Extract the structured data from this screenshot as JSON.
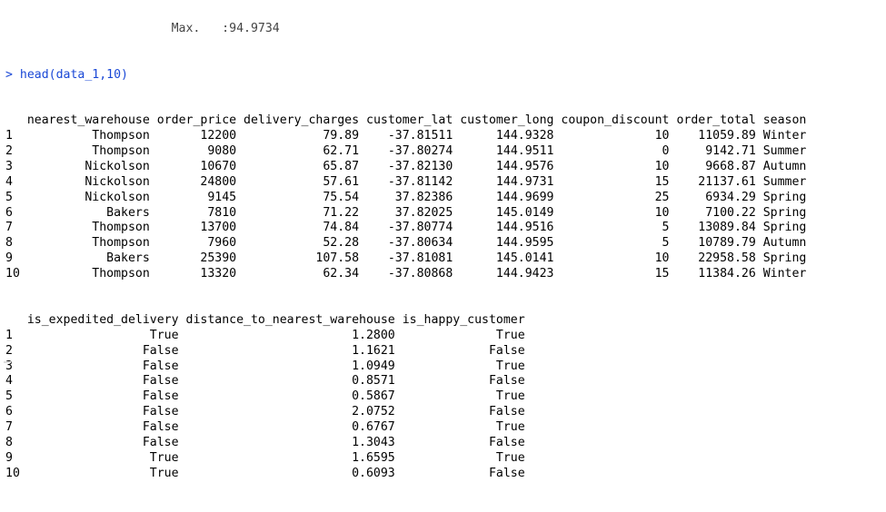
{
  "console": {
    "cut_line": "                       Max.   :94.9734",
    "prompt_symbol": ">",
    "command": "head(data_1,10)",
    "table1": {
      "headers": [
        "nearest_warehouse",
        "order_price",
        "delivery_charges",
        "customer_lat",
        "customer_long",
        "coupon_discount",
        "order_total",
        "season"
      ],
      "rows": [
        [
          "1",
          "Thompson",
          "12200",
          "79.89",
          "-37.81511",
          "144.9328",
          "10",
          "11059.89",
          "Winter"
        ],
        [
          "2",
          "Thompson",
          "9080",
          "62.71",
          "-37.80274",
          "144.9511",
          "0",
          "9142.71",
          "Summer"
        ],
        [
          "3",
          "Nickolson",
          "10670",
          "65.87",
          "-37.82130",
          "144.9576",
          "10",
          "9668.87",
          "Autumn"
        ],
        [
          "4",
          "Nickolson",
          "24800",
          "57.61",
          "-37.81142",
          "144.9731",
          "15",
          "21137.61",
          "Summer"
        ],
        [
          "5",
          "Nickolson",
          "9145",
          "75.54",
          "37.82386",
          "144.9699",
          "25",
          "6934.29",
          "Spring"
        ],
        [
          "6",
          "Bakers",
          "7810",
          "71.22",
          "37.82025",
          "145.0149",
          "10",
          "7100.22",
          "Spring"
        ],
        [
          "7",
          "Thompson",
          "13700",
          "74.84",
          "-37.80774",
          "144.9516",
          "5",
          "13089.84",
          "Spring"
        ],
        [
          "8",
          "Thompson",
          "7960",
          "52.28",
          "-37.80634",
          "144.9595",
          "5",
          "10789.79",
          "Autumn"
        ],
        [
          "9",
          "Bakers",
          "25390",
          "107.58",
          "-37.81081",
          "145.0141",
          "10",
          "22958.58",
          "Spring"
        ],
        [
          "10",
          "Thompson",
          "13320",
          "62.34",
          "-37.80868",
          "144.9423",
          "15",
          "11384.26",
          "Winter"
        ]
      ]
    },
    "table2": {
      "headers": [
        "is_expedited_delivery",
        "distance_to_nearest_warehouse",
        "is_happy_customer"
      ],
      "rows": [
        [
          "1",
          "True",
          "1.2800",
          "True"
        ],
        [
          "2",
          "False",
          "1.1621",
          "False"
        ],
        [
          "3",
          "False",
          "1.0949",
          "True"
        ],
        [
          "4",
          "False",
          "0.8571",
          "False"
        ],
        [
          "5",
          "False",
          "0.5867",
          "True"
        ],
        [
          "6",
          "False",
          "2.0752",
          "False"
        ],
        [
          "7",
          "False",
          "0.6767",
          "True"
        ],
        [
          "8",
          "False",
          "1.3043",
          "False"
        ],
        [
          "9",
          "True",
          "1.6595",
          "True"
        ],
        [
          "10",
          "True",
          "0.6093",
          "False"
        ]
      ]
    }
  }
}
